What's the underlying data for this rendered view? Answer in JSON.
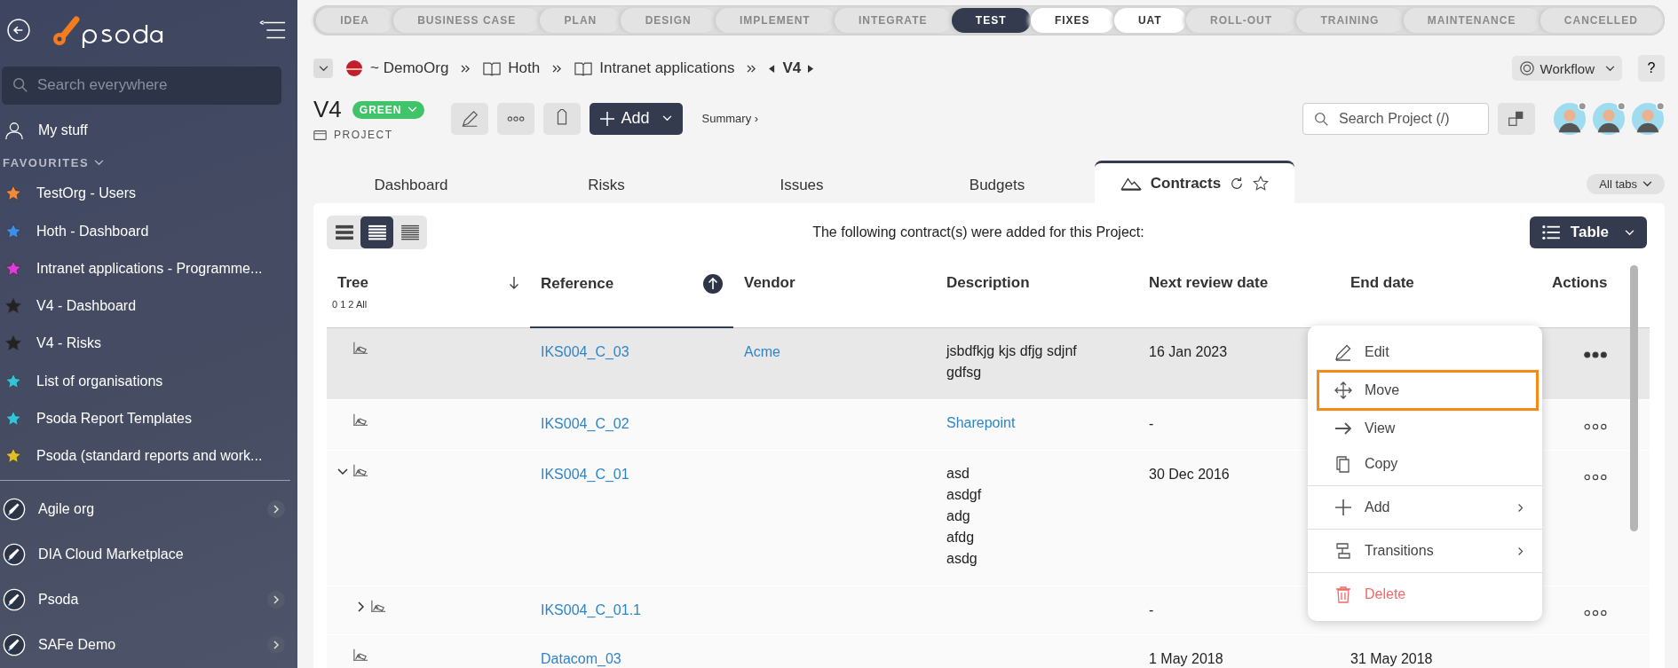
{
  "sidebar": {
    "search": {
      "placeholder": "Search everywhere"
    },
    "my_stuff": "My stuff",
    "favourites_heading": "FAVOURITES",
    "favourites": [
      {
        "label": "TestOrg - Users",
        "color": "#f28a3c"
      },
      {
        "label": "Hoth - Dashboard",
        "color": "#3b8fe8"
      },
      {
        "label": "Intranet applications - Programme...",
        "color": "#e03ad8"
      },
      {
        "label": "V4 - Dashboard",
        "color": "#222222"
      },
      {
        "label": "V4 - Risks",
        "color": "#222222"
      },
      {
        "label": "List of organisations",
        "color": "#33c4dc"
      },
      {
        "label": "Psoda Report Templates",
        "color": "#33c4dc"
      },
      {
        "label": "Psoda (standard reports and work...",
        "color": "#e2bd2a"
      }
    ],
    "organisations": [
      {
        "label": "Agile org",
        "has_children": true
      },
      {
        "label": "DIA Cloud Marketplace",
        "has_children": false
      },
      {
        "label": "Psoda",
        "has_children": true
      },
      {
        "label": "SAFe Demo",
        "has_children": true
      }
    ]
  },
  "stages": [
    {
      "label": "IDEA",
      "kind": "past"
    },
    {
      "label": "BUSINESS CASE",
      "kind": "past"
    },
    {
      "label": "PLAN",
      "kind": "past"
    },
    {
      "label": "DESIGN",
      "kind": "past"
    },
    {
      "label": "IMPLEMENT",
      "kind": "past"
    },
    {
      "label": "INTEGRATE",
      "kind": "past"
    },
    {
      "label": "TEST",
      "kind": "current"
    },
    {
      "label": "FIXES",
      "kind": "next"
    },
    {
      "label": "UAT",
      "kind": "next"
    },
    {
      "label": "ROLL-OUT",
      "kind": "future"
    },
    {
      "label": "TRAINING",
      "kind": "future"
    },
    {
      "label": "MAINTENANCE",
      "kind": "future"
    },
    {
      "label": "CANCELLED",
      "kind": "future"
    }
  ],
  "breadcrumbs": [
    {
      "label": "~ DemoOrg",
      "kind": "org"
    },
    {
      "label": "Hoth",
      "kind": "book"
    },
    {
      "label": "Intranet applications",
      "kind": "book"
    },
    {
      "label": "V4",
      "kind": "current"
    }
  ],
  "workflow_button": "Workflow",
  "help_button": "?",
  "project": {
    "title": "V4",
    "status": {
      "label": "GREEN",
      "color": "#3fc46a"
    },
    "type": "PROJECT",
    "add_button": "Add",
    "summary_link": "Summary ›",
    "search": {
      "placeholder": "Search Project (/)"
    }
  },
  "tabs": [
    {
      "label": "Dashboard",
      "selected": false
    },
    {
      "label": "Risks",
      "selected": false
    },
    {
      "label": "Issues",
      "selected": false
    },
    {
      "label": "Budgets",
      "selected": false
    },
    {
      "label": "Contracts",
      "selected": true
    }
  ],
  "all_tabs_button": "All tabs",
  "view_density": [
    {
      "selected": false
    },
    {
      "selected": true
    },
    {
      "selected": false
    }
  ],
  "intro": "The following contract(s) were added for this Project:",
  "view_button": "Table",
  "table": {
    "columns": [
      "Tree",
      "Reference",
      "Vendor",
      "Description",
      "Next review date",
      "End date",
      "Actions"
    ],
    "tree_levels": "0 1 2 All",
    "rows": [
      {
        "reference": "IKS004_C_03",
        "vendor": "Acme",
        "description": [
          "jsbdfkjg kjs dfjg sdjnf",
          "gdfsg"
        ],
        "description_link": false,
        "next_review": "16 Jan 2023",
        "selected": true
      },
      {
        "reference": "IKS004_C_02",
        "description": [
          "Sharepoint"
        ],
        "description_link": true,
        "next_review": "-",
        "selected": false
      },
      {
        "reference": "IKS004_C_01",
        "description": [
          "asd",
          "asdgf",
          "adg",
          "afdg",
          "asdg"
        ],
        "description_link": false,
        "next_review": "30 Dec 2016",
        "selected": false,
        "expanded": true,
        "children": [
          {
            "reference": "IKS004_C_01.1",
            "next_review": "-",
            "selected": false,
            "expanded": false
          }
        ]
      },
      {
        "reference": "Datacom_03",
        "next_review": "1 May 2018",
        "end_date": "31 May 2018",
        "selected": false
      }
    ]
  },
  "context_menu": {
    "groups": [
      [
        {
          "label": "Edit",
          "kind": "edit",
          "highlighted": false
        },
        {
          "label": "Move",
          "kind": "move",
          "highlighted": true
        },
        {
          "label": "View",
          "kind": "view",
          "highlighted": false
        },
        {
          "label": "Copy",
          "kind": "copy",
          "highlighted": false
        }
      ],
      [
        {
          "label": "Add",
          "kind": "add",
          "highlighted": false,
          "submenu": true
        }
      ],
      [
        {
          "label": "Transitions",
          "kind": "transitions",
          "highlighted": false,
          "submenu": true
        }
      ],
      [
        {
          "label": "Delete",
          "kind": "delete",
          "highlighted": false
        }
      ]
    ]
  }
}
